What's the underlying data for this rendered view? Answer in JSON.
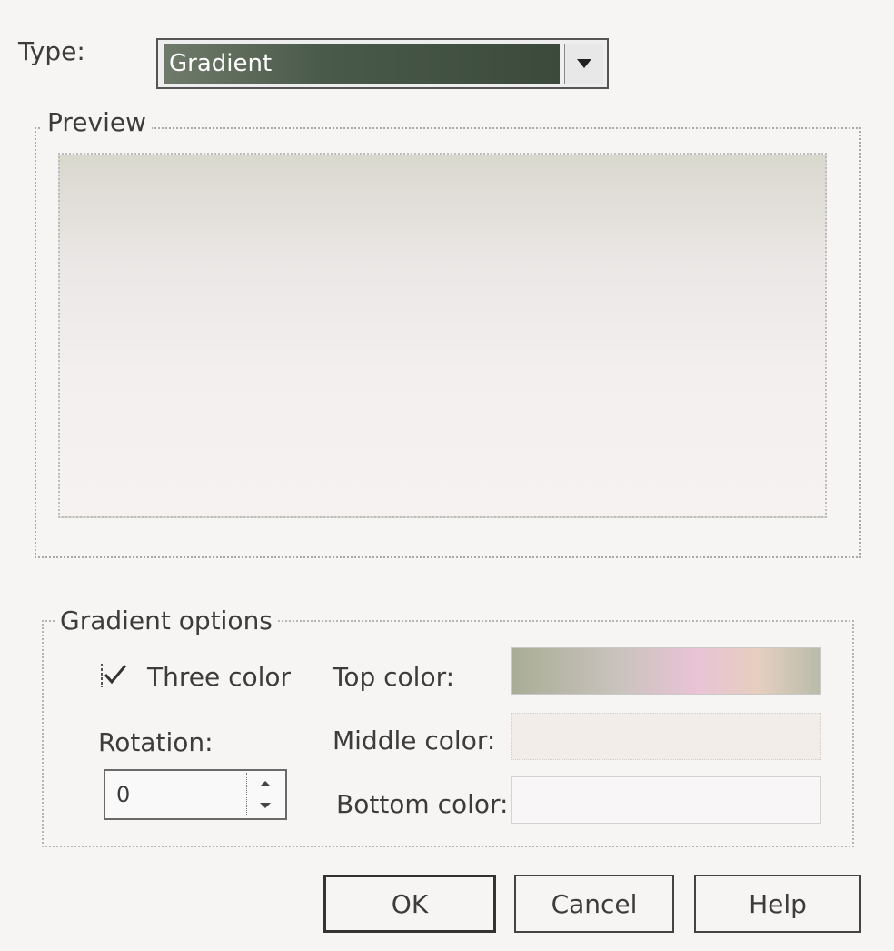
{
  "type": {
    "label": "Type:",
    "value": "Gradient"
  },
  "preview": {
    "title": "Preview"
  },
  "gradient_options": {
    "title": "Gradient options",
    "three_color": {
      "label": "Three color",
      "checked": true
    },
    "rotation": {
      "label": "Rotation:",
      "value": "0"
    },
    "top_color": {
      "label": "Top color:"
    },
    "middle_color": {
      "label": "Middle color:"
    },
    "bottom_color": {
      "label": "Bottom color:"
    }
  },
  "buttons": {
    "ok": "OK",
    "cancel": "Cancel",
    "help": "Help"
  },
  "icons": {
    "dropdown": "chevron-down-icon",
    "checkbox": "checkmark-icon",
    "spin_up": "spin-up-icon",
    "spin_down": "spin-down-icon"
  },
  "colors": {
    "selection_bg": "#4a5a4a",
    "dialog_bg": "#f7f5f3"
  }
}
